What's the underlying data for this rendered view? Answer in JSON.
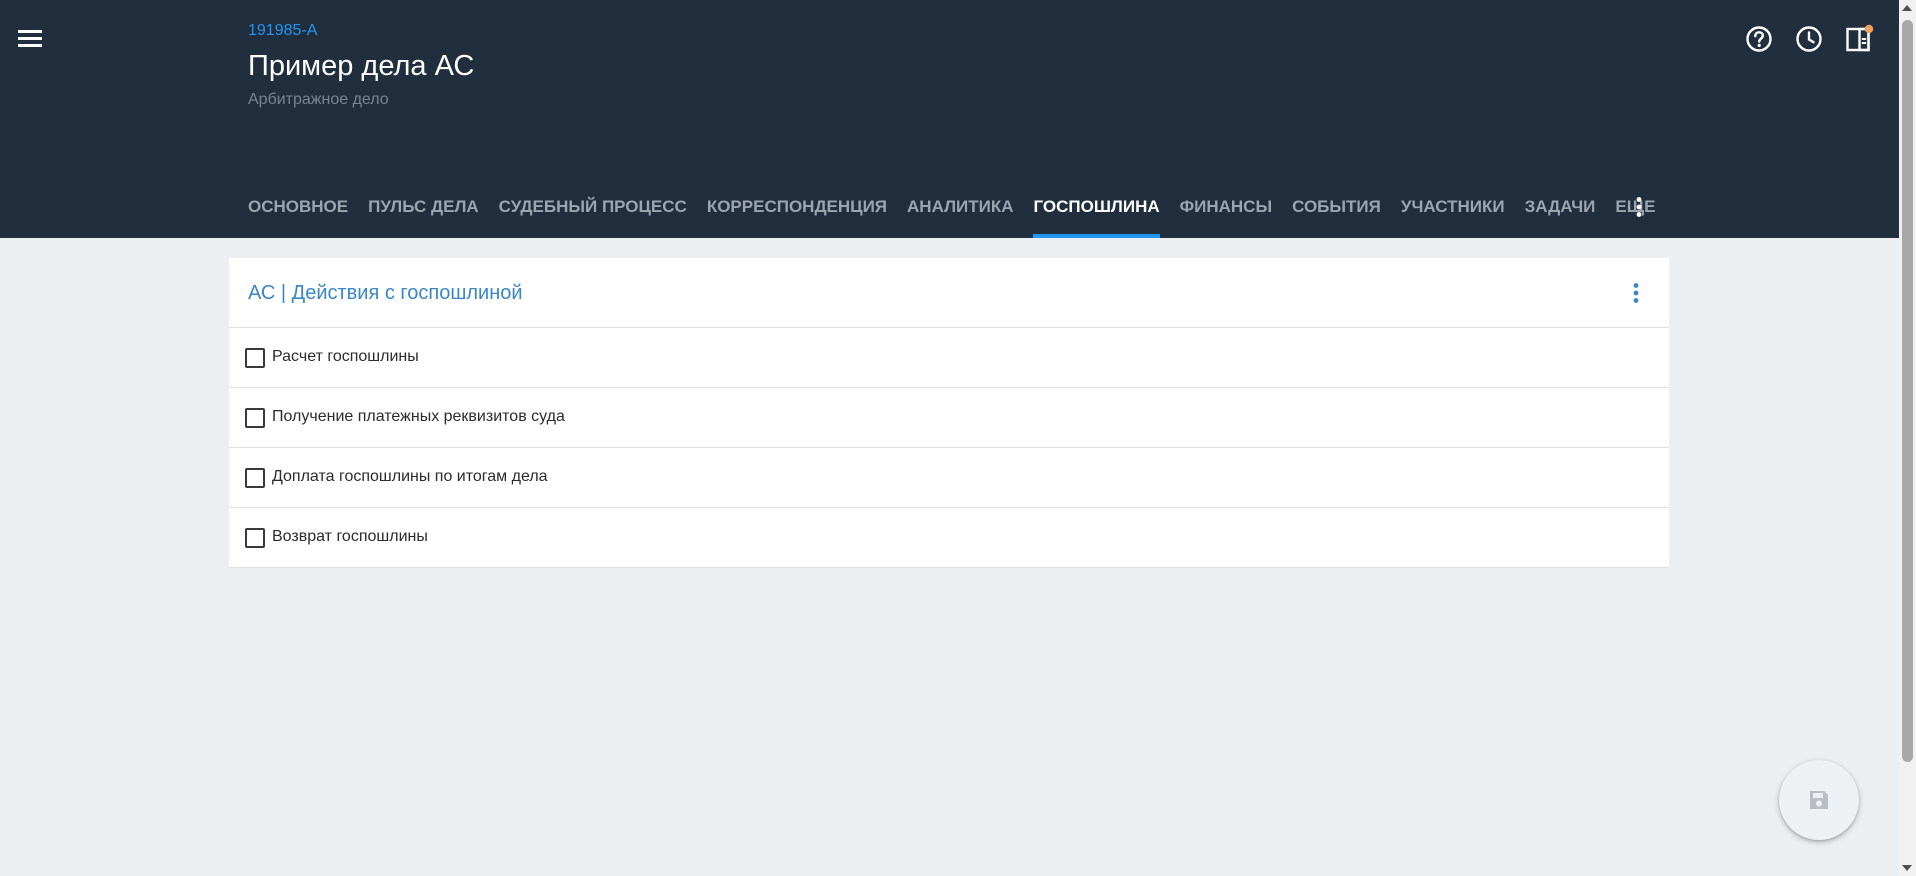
{
  "header": {
    "case_number": "191985-A",
    "case_title": "Пример дела АС",
    "case_type": "Арбитражное дело",
    "icons": [
      "menu-icon",
      "help-icon",
      "clock-icon",
      "panel-icon"
    ],
    "notification_color": "#f0a35e"
  },
  "tabs": [
    {
      "label": "Основное",
      "active": false
    },
    {
      "label": "Пульс дела",
      "active": false
    },
    {
      "label": "Судебный процесс",
      "active": false
    },
    {
      "label": "Корреспонденция",
      "active": false
    },
    {
      "label": "Аналитика",
      "active": false
    },
    {
      "label": "Госпошлина",
      "active": true
    },
    {
      "label": "Финансы",
      "active": false
    },
    {
      "label": "События",
      "active": false
    },
    {
      "label": "Участники",
      "active": false
    },
    {
      "label": "Задачи",
      "active": false
    },
    {
      "label": "Еще",
      "active": false
    }
  ],
  "card": {
    "title": "АС | Действия с госпошлиной",
    "items": [
      {
        "label": "Расчет госпошлины",
        "checked": false
      },
      {
        "label": "Получение платежных реквизитов суда",
        "checked": false
      },
      {
        "label": "Доплата госпошлины по итогам дела",
        "checked": false
      },
      {
        "label": "Возврат госпошлины",
        "checked": false
      }
    ]
  },
  "colors": {
    "header_bg": "#212e3e",
    "accent": "#2196f3",
    "card_title": "#3a86c8",
    "page_bg": "#eceff1"
  },
  "fab": {
    "icon": "save-icon"
  }
}
